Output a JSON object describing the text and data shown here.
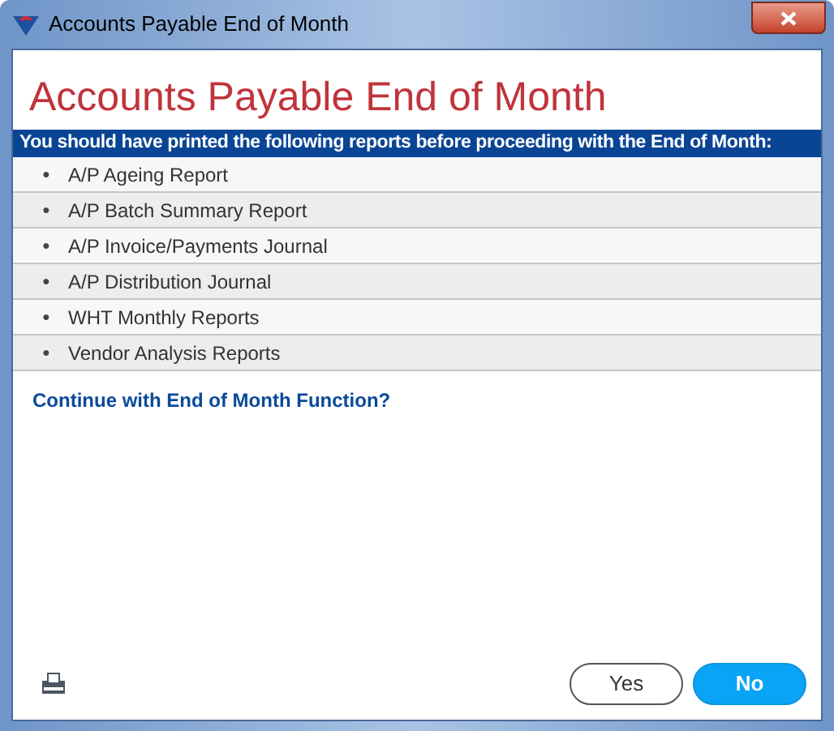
{
  "window": {
    "title": "Accounts Payable End of Month"
  },
  "heading": "Accounts Payable End of Month",
  "banner": "You should have printed the following reports before proceeding with the End of Month:",
  "reports": [
    {
      "bullet": "●",
      "label": "A/P Ageing Report"
    },
    {
      "bullet": "●",
      "label": "A/P Batch Summary Report"
    },
    {
      "bullet": "●",
      "label": "A/P Invoice/Payments Journal"
    },
    {
      "bullet": "●",
      "label": "A/P Distribution Journal"
    },
    {
      "bullet": "●",
      "label": "WHT Monthly Reports"
    },
    {
      "bullet": "●",
      "label": "Vendor Analysis Reports"
    }
  ],
  "question": "Continue with End of Month Function?",
  "buttons": [
    {
      "label": "Yes",
      "primary": false
    },
    {
      "label": "No",
      "primary": true
    }
  ]
}
